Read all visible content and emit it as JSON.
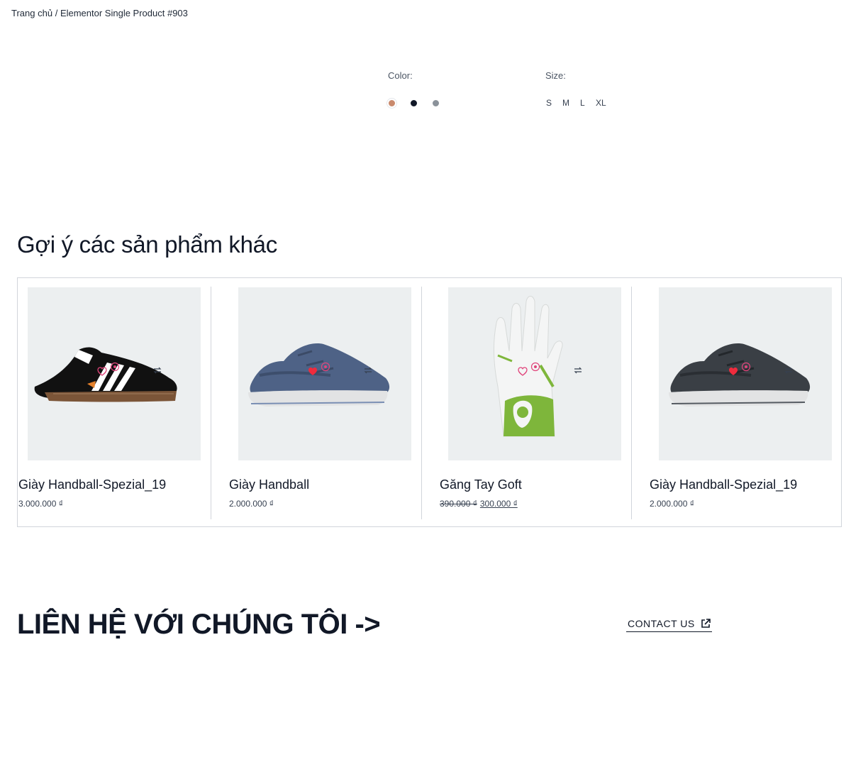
{
  "breadcrumb": {
    "home": "Trang chủ",
    "separator": "/",
    "current": "Elementor Single Product #903"
  },
  "options": {
    "color_label": "Color:",
    "colors": [
      "#c98a6d",
      "#111827",
      "#8b929a"
    ],
    "size_label": "Size:",
    "sizes": [
      "S",
      "M",
      "L",
      "XL"
    ]
  },
  "related": {
    "title": "Gợi ý các sản phẩm khác",
    "products": [
      {
        "name": "Giày Handball-Spezial_19",
        "price": "3.000.000 ₫",
        "wishlisted": false
      },
      {
        "name": "Giày Handball",
        "price": "2.000.000 ₫",
        "wishlisted": true
      },
      {
        "name": "Găng Tay Goft",
        "old_price": "390.000 ₫",
        "price": "300.000 ₫",
        "wishlisted": false
      },
      {
        "name": "Giày Handball-Spezial_19",
        "price": "2.000.000 ₫",
        "wishlisted": true
      }
    ]
  },
  "contact": {
    "title": "LIÊN HỆ VỚI CHÚNG TÔI ->",
    "link_label": "CONTACT US"
  },
  "icons": {
    "wishlist": "heart-icon",
    "quick_view": "eye-icon",
    "compare": "compare-arrows-icon",
    "external": "external-link-icon"
  },
  "colors": {
    "heart_active": "#ef2b3d",
    "heart_outline": "#e0457b",
    "text": "#111827",
    "image_bg": "#eceff0"
  }
}
